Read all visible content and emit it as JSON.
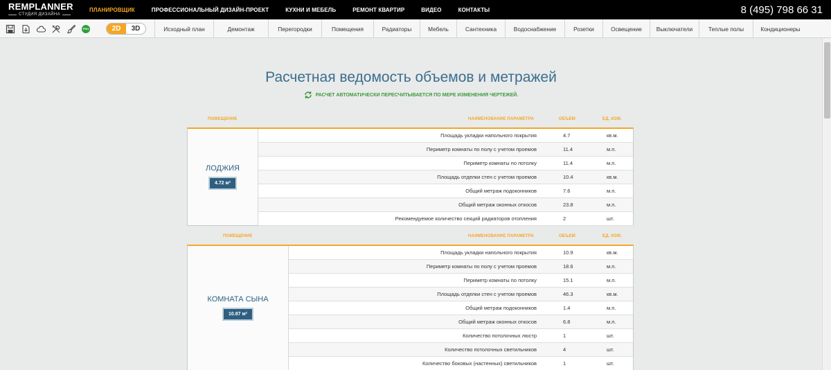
{
  "logo": {
    "main": "REMPLANNER",
    "sub": "СТУДИЯ ДИЗАЙНА"
  },
  "topnav": [
    {
      "label": "ПЛАНИРОВЩИК",
      "active": true
    },
    {
      "label": "ПРОФЕССИОНАЛЬНЫЙ ДИЗАЙН-ПРОЕКТ",
      "active": false
    },
    {
      "label": "КУХНИ И МЕБЕЛЬ",
      "active": false
    },
    {
      "label": "РЕМОНТ КВАРТИР",
      "active": false
    },
    {
      "label": "ВИДЕО",
      "active": false
    },
    {
      "label": "КОНТАКТЫ",
      "active": false
    }
  ],
  "phone": "8 (495) 798 66 31",
  "toolbar": {
    "icons": [
      "save-icon",
      "export-icon",
      "cloud-icon",
      "tools-icon",
      "brush-icon",
      "pro-icon"
    ],
    "pro_label": "PRO",
    "view_2d": "2D",
    "view_3d": "3D",
    "tabs": [
      "Исходный план",
      "Демонтаж",
      "Перегородки",
      "Помещения",
      "Радиаторы",
      "Мебель",
      "Сантехника",
      "Водоснабжение",
      "Розетки",
      "Освещение",
      "Выключатели",
      "Теплые полы",
      "Кондиционеры"
    ]
  },
  "colors": {
    "accent": "#f5a623",
    "title": "#3a6e8f",
    "room": "#2f5f80",
    "ok": "#3d9b3d"
  },
  "title": "Расчетная ведомость объемов и метражей",
  "subtitle": "РАСЧЕТ АВТОМАТИЧЕСКИ ПЕРЕСЧИТЫВАЕТСЯ ПО МЕРЕ ИЗМЕНЕНИЯ ЧЕРТЕЖЕЙ.",
  "headers": {
    "room": "ПОМЕЩЕНИЕ",
    "param": "НАИМЕНОВАНИЕ ПАРАМЕТРА",
    "value": "ОБЪЕМ",
    "unit": "ЕД. ИЗМ."
  },
  "rooms": [
    {
      "name": "ЛОДЖИЯ",
      "area": "4.72 м²",
      "rows": [
        {
          "param": "Площадь укладки напольного покрытия",
          "value": "4.7",
          "unit": "кв.м."
        },
        {
          "param": "Периметр комнаты по полу с учетом проемов",
          "value": "11.4",
          "unit": "м.п."
        },
        {
          "param": "Периметр комнаты по потолку",
          "value": "11.4",
          "unit": "м.п."
        },
        {
          "param": "Площадь отделки стен с учетом проемов",
          "value": "10.4",
          "unit": "кв.м."
        },
        {
          "param": "Общий метраж подоконников",
          "value": "7.6",
          "unit": "м.п."
        },
        {
          "param": "Общий метраж оконных откосов",
          "value": "23.8",
          "unit": "м.п."
        },
        {
          "param": "Рекомендуемое количество секций радиаторов отопления",
          "value": "2",
          "unit": "шт."
        }
      ]
    },
    {
      "name": "КОМНАТА СЫНА",
      "area": "10.87 м²",
      "rows": [
        {
          "param": "Площадь укладки напольного покрытия",
          "value": "10.9",
          "unit": "кв.м."
        },
        {
          "param": "Периметр комнаты по полу с учетом проемов",
          "value": "18.6",
          "unit": "м.п."
        },
        {
          "param": "Периметр комнаты по потолку",
          "value": "15.1",
          "unit": "м.п."
        },
        {
          "param": "Площадь отделки стен с учетом проемов",
          "value": "46.3",
          "unit": "кв.м."
        },
        {
          "param": "Общий метраж подоконников",
          "value": "1.4",
          "unit": "м.п."
        },
        {
          "param": "Общий метраж оконных откосов",
          "value": "6.8",
          "unit": "м.п."
        },
        {
          "param": "Количество потолочных люстр",
          "value": "1",
          "unit": "шт."
        },
        {
          "param": "Количество потолочных светильников",
          "value": "4",
          "unit": "шт."
        },
        {
          "param": "Количество боковых (настенных) светильников",
          "value": "1",
          "unit": "шт."
        }
      ]
    }
  ]
}
